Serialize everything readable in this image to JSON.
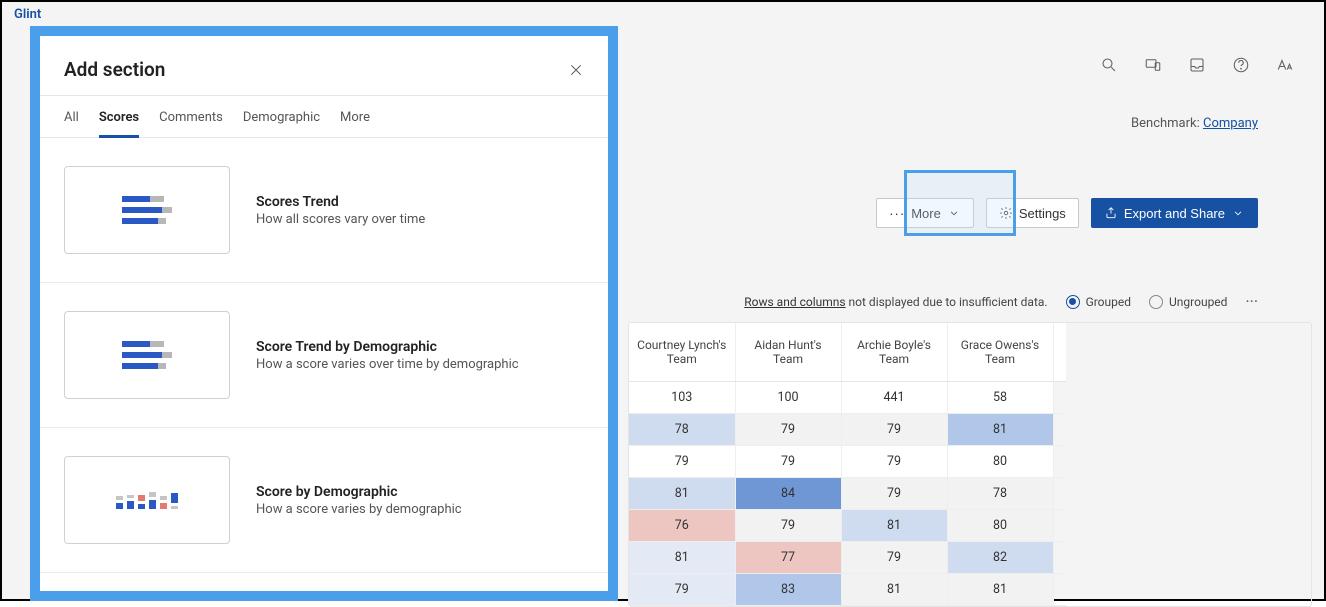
{
  "app": {
    "name": "Glint"
  },
  "benchmark": {
    "label": "Benchmark:",
    "link_text": "Company"
  },
  "toolbar": {
    "more_label": "More",
    "settings_label": "Settings",
    "export_label": "Export and Share"
  },
  "table_info": {
    "link_text": "Rows and columns",
    "warning_suffix": " not displayed due to insufficient data.",
    "grouped_label": "Grouped",
    "ungrouped_label": "Ungrouped",
    "selected_grouping": "grouped"
  },
  "table": {
    "headers": [
      "Courtney Lynch's Team",
      "Aidan Hunt's Team",
      "Archie Boyle's Team",
      "Grace Owens's Team"
    ],
    "rows": [
      {
        "cells": [
          {
            "v": "103",
            "c": "blank"
          },
          {
            "v": "100",
            "c": "blank"
          },
          {
            "v": "441",
            "c": "blank"
          },
          {
            "v": "58",
            "c": "blank"
          }
        ]
      },
      {
        "cells": [
          {
            "v": "78",
            "c": "lblue"
          },
          {
            "v": "79",
            "c": "lgray"
          },
          {
            "v": "79",
            "c": "lgray"
          },
          {
            "v": "81",
            "c": "mblue"
          }
        ]
      },
      {
        "cells": [
          {
            "v": "79",
            "c": "blank"
          },
          {
            "v": "79",
            "c": "blank"
          },
          {
            "v": "79",
            "c": "blank"
          },
          {
            "v": "80",
            "c": "blank"
          }
        ]
      },
      {
        "cells": [
          {
            "v": "81",
            "c": "lblue"
          },
          {
            "v": "84",
            "c": "dblue"
          },
          {
            "v": "79",
            "c": "lgray"
          },
          {
            "v": "78",
            "c": "lgray"
          }
        ]
      },
      {
        "cells": [
          {
            "v": "76",
            "c": "lred"
          },
          {
            "v": "79",
            "c": "lgray"
          },
          {
            "v": "81",
            "c": "lblue"
          },
          {
            "v": "80",
            "c": "lgray"
          }
        ]
      },
      {
        "cells": [
          {
            "v": "81",
            "c": "vlblue"
          },
          {
            "v": "77",
            "c": "lred"
          },
          {
            "v": "79",
            "c": "lgray"
          },
          {
            "v": "82",
            "c": "lblue"
          }
        ]
      },
      {
        "cells": [
          {
            "v": "79",
            "c": "vlblue"
          },
          {
            "v": "83",
            "c": "mblue"
          },
          {
            "v": "81",
            "c": "lgray"
          },
          {
            "v": "81",
            "c": "lgray"
          }
        ]
      }
    ]
  },
  "modal": {
    "title": "Add section",
    "tabs": [
      "All",
      "Scores",
      "Comments",
      "Demographic",
      "More"
    ],
    "active_tab": "Scores",
    "sections": [
      {
        "title": "Scores Trend",
        "desc": "How all scores vary over time",
        "thumb": "bars"
      },
      {
        "title": "Score Trend by Demographic",
        "desc": "How a score varies over time by demographic",
        "thumb": "bars"
      },
      {
        "title": "Score by Demographic",
        "desc": "How a score varies by demographic",
        "thumb": "demo"
      }
    ]
  }
}
